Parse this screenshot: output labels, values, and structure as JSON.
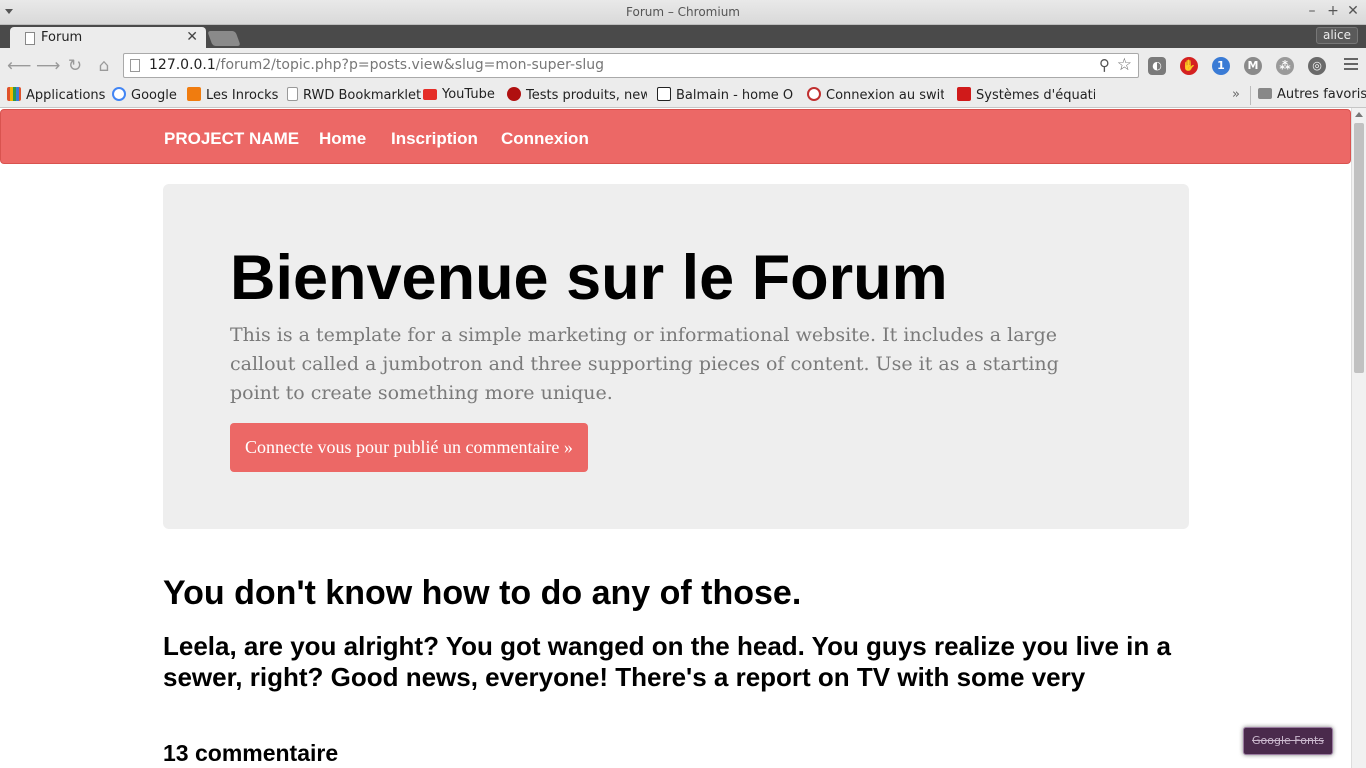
{
  "window": {
    "title": "Forum – Chromium",
    "minimize": "–",
    "maximize": "+",
    "close": "✕"
  },
  "tabs": [
    {
      "title": "Forum",
      "close": "✕"
    }
  ],
  "profile": "alice",
  "toolbar": {
    "back": "⟵",
    "forward": "⟶",
    "reload": "↻",
    "home": "⌂",
    "url_host": "127.0.0.1",
    "url_rest": "/forum2/topic.php?p=posts.view&slug=mon-super-slug",
    "zoom_icon": "⚲",
    "star_icon": "☆"
  },
  "extensions": [
    {
      "icon": "ext-gray-icon",
      "color": "#7a7a7a",
      "glyph": "◐"
    },
    {
      "icon": "ublock-icon",
      "color": "#d42121",
      "glyph": "✋"
    },
    {
      "icon": "ghostery-icon",
      "color": "#3a7bd5",
      "glyph": "1"
    },
    {
      "icon": "m-icon",
      "color": "#8a8a8a",
      "glyph": "M"
    },
    {
      "icon": "share-icon",
      "color": "#888888",
      "glyph": "⁂"
    },
    {
      "icon": "target-icon",
      "color": "#6a6a6a",
      "glyph": "◎"
    }
  ],
  "bookmarks": [
    {
      "label": "Applications",
      "icon": "apps-grid-icon",
      "color": "#e0522a"
    },
    {
      "label": "Google",
      "icon": "google-icon",
      "color": "#4285f4"
    },
    {
      "label": "Les Inrocks",
      "icon": "inrocks-icon",
      "color": "#f07c0f"
    },
    {
      "label": "RWD Bookmarklet",
      "icon": "page-icon",
      "color": "#ffffff"
    },
    {
      "label": "YouTube",
      "icon": "youtube-icon",
      "color": "#e52d27"
    },
    {
      "label": "Tests produits, new",
      "icon": "tests-icon",
      "color": "#b01010"
    },
    {
      "label": "Balmain - home On",
      "icon": "balmain-icon",
      "color": "#222222"
    },
    {
      "label": "Connexion au switc",
      "icon": "shield-icon",
      "color": "#c03030"
    },
    {
      "label": "Systèmes d'équatio",
      "icon": "free-icon",
      "color": "#d01a1a"
    }
  ],
  "bookmarks_more": "»",
  "other_bookmarks": "Autres favoris",
  "nav": {
    "brand": "PROJECT NAME",
    "links": [
      "Home",
      "Inscription",
      "Connexion"
    ]
  },
  "jumbotron": {
    "heading": "Bienvenue sur le Forum",
    "text": "This is a template for a simple marketing or informational website. It includes a large callout called a jumbotron and three supporting pieces of content. Use it as a starting point to create something more unique.",
    "button": "Connecte vous pour publié un commentaire »"
  },
  "topic": {
    "title": "You don't know how to do any of those.",
    "body": "Leela, are you alright? You got wanged on the head. You guys realize you live in a sewer, right? Good news, everyone! There's a report on TV with some very",
    "comments": "13 commentaire"
  },
  "badge": "Google Fonts",
  "colors": {
    "brand": "#ec6866",
    "jumbotron_bg": "#eeeeee"
  }
}
